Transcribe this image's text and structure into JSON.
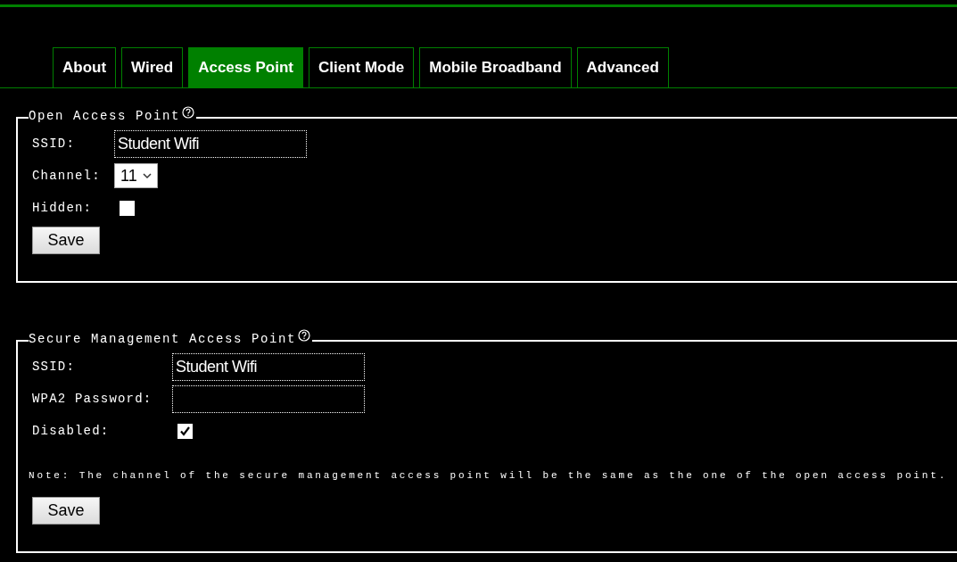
{
  "tabs": [
    {
      "label": "About",
      "selected": false
    },
    {
      "label": "Wired",
      "selected": false
    },
    {
      "label": "Access Point",
      "selected": true
    },
    {
      "label": "Client Mode",
      "selected": false
    },
    {
      "label": "Mobile Broadband",
      "selected": false
    },
    {
      "label": "Advanced",
      "selected": false
    }
  ],
  "sections": [
    {
      "title": "Open Access Point",
      "fields": [
        {
          "kind": "text",
          "label": "SSID:",
          "value": "Student Wifi"
        },
        {
          "kind": "select",
          "label": "Channel:",
          "value": "11"
        },
        {
          "kind": "checkbox",
          "label": "Hidden:",
          "checked": false
        }
      ],
      "save": "Save"
    },
    {
      "title": "Secure Management Access Point",
      "fields": [
        {
          "kind": "text",
          "label": "SSID:",
          "value": "Student Wifi"
        },
        {
          "kind": "text",
          "label": "WPA2 Password:"
        },
        {
          "kind": "checkbox",
          "label": "Disabled:",
          "checked": true
        }
      ],
      "note": "Note: The channel of the secure management access point will be the same as the one of the open access point.",
      "save": "Save"
    }
  ]
}
